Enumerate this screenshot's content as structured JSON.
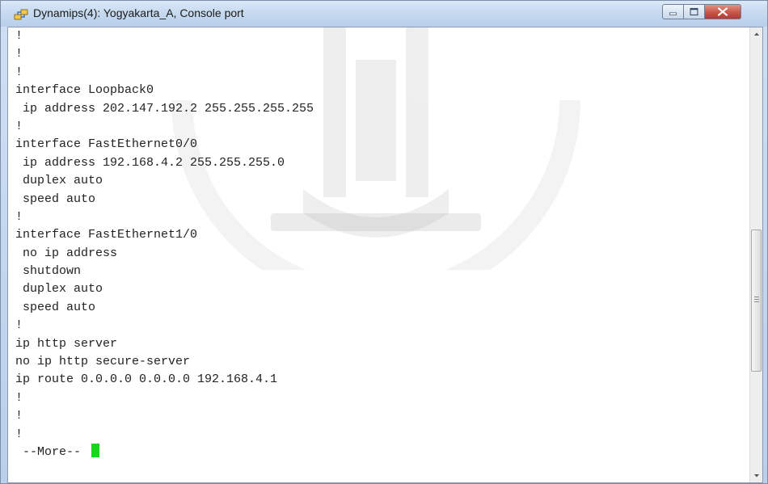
{
  "window": {
    "title": "Dynamips(4): Yogyakarta_A, Console port",
    "controls": {
      "minimize_icon": "minimize-icon",
      "maximize_icon": "maximize-icon",
      "close_icon": "close-icon"
    }
  },
  "console": {
    "lines": [
      "!",
      "!",
      "!",
      "interface Loopback0",
      " ip address 202.147.192.2 255.255.255.255",
      "!",
      "interface FastEthernet0/0",
      " ip address 192.168.4.2 255.255.255.0",
      " duplex auto",
      " speed auto",
      "!",
      "interface FastEthernet1/0",
      " no ip address",
      " shutdown",
      " duplex auto",
      " speed auto",
      "!",
      "ip http server",
      "no ip http secure-server",
      "ip route 0.0.0.0 0.0.0.0 192.168.4.1",
      "!",
      "!",
      "!"
    ],
    "more_prompt": " --More-- ",
    "cursor_color": "#19d421"
  },
  "scrollbar": {
    "position_fraction": 0.66
  }
}
